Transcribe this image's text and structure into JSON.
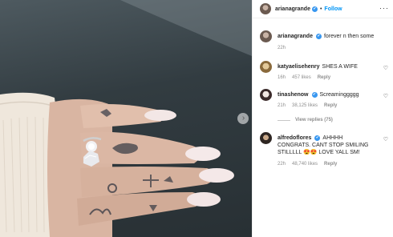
{
  "post": {
    "author": "arianagrande",
    "follow_label": "Follow",
    "separator": "•",
    "more_label": "···",
    "caption": {
      "username": "arianagrande",
      "text": "forever n then some",
      "age": "22h"
    },
    "comments": [
      {
        "username": "katyaelisehenry",
        "verified": false,
        "text": "SHES A WIFE",
        "age": "16h",
        "likes": "457 likes",
        "reply_label": "Reply"
      },
      {
        "username": "tinashenow",
        "verified": true,
        "text": "Screaminggggg",
        "age": "21h",
        "likes": "38,125 likes",
        "reply_label": "Reply",
        "view_replies": "View replies (75)"
      },
      {
        "username": "alfredoflores",
        "verified": true,
        "text": "AHHHH CONGRATS. CANT STOP SMILING STILLLLL 😍😍 LOVE YALL SM!",
        "age": "22h",
        "likes": "48,740 likes",
        "reply_label": "Reply"
      }
    ],
    "icons": {
      "verified": "✔",
      "heart": "♡",
      "next": "›"
    },
    "colors": {
      "follow": "#0095f6",
      "verified": "#3897f0",
      "meta": "#8e8e8e"
    }
  }
}
